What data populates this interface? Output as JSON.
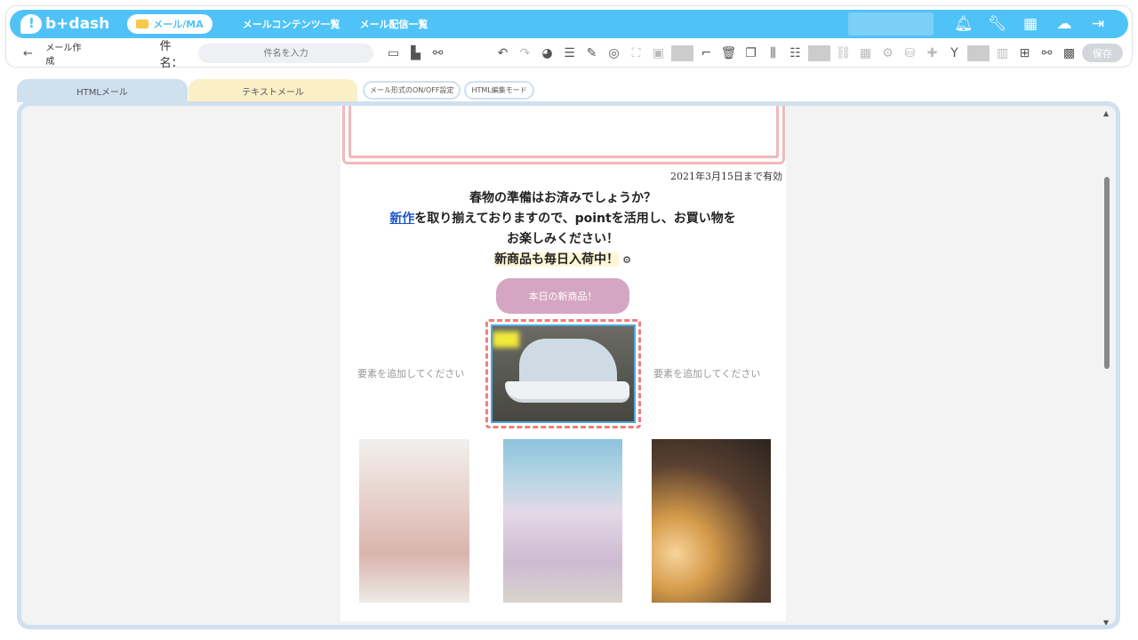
{
  "app": {
    "brand": "b+dash",
    "module_pill": "メール/MA"
  },
  "nav": {
    "links": [
      "メールコンテンツ一覧",
      "メール配信一覧"
    ]
  },
  "header_icons": [
    "bell-icon",
    "wrench-icon",
    "apps-grid-icon",
    "user-cloud-icon",
    "logout-icon"
  ],
  "page": {
    "back_label": "←",
    "title": "メール作成"
  },
  "subject": {
    "label": "件名：",
    "placeholder": "件名を入力"
  },
  "toolbar": {
    "save_label": "保存"
  },
  "tabs": {
    "html": "HTMLメール",
    "text": "テキストメール",
    "toggle_btn": "メール形式のON/OFF設定",
    "edit_mode_btn": "HTML編集モード"
  },
  "mail": {
    "valid_until": "2021年3月15日まで有効",
    "line1": "春物の準備はお済みでしょうか？",
    "line2_link": "新作",
    "line2_rest": "を取り揃えておりますので、pointを活用し、お買い物を",
    "line3": "お楽しみください！",
    "line4": "新商品も毎日入荷中！",
    "cta": "本日の新商品！",
    "add_element_left": "要素を追加してください",
    "add_element_right": "要素を追加してください"
  },
  "colors": {
    "accent": "#4fc3f7",
    "cta": "#d5a6c1",
    "frame": "#f1b9bb",
    "selection": "#f07d7d"
  }
}
